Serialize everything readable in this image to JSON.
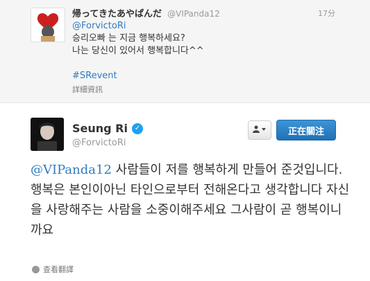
{
  "tweet1": {
    "name": "帰ってきたあやぱんだ",
    "handle": "@VIPanda12",
    "time": "17分",
    "mention": "@ForvictoRi",
    "line1": "승리오빠 는 지금 행복하세요?",
    "line2": "나는 당신이 있어서 행복합니다^^",
    "hashtag": "#SRevent",
    "details": "詳細資訊"
  },
  "tweet2": {
    "name": "Seung Ri",
    "handle": "@ForvictoRi",
    "follow_label": "正在關注",
    "mention": "@VIPanda12",
    "body": " 사람들이 저를 행복하게 만들어 준것입니다. 행복은 본인이아닌 타인으로부터 전해온다고 생각합니다 자신을 사랑해주는 사람을 소중이해주세요 그사람이 곧 행복이니까요",
    "translate": "查看翻譯"
  },
  "icons": {
    "verified": "verified-badge-icon",
    "user_menu": "user-dropdown-icon",
    "translate": "globe-icon"
  },
  "colors": {
    "link": "#2f7bbf",
    "follow_button": "#2a7fc4",
    "verified": "#1da1f2"
  }
}
